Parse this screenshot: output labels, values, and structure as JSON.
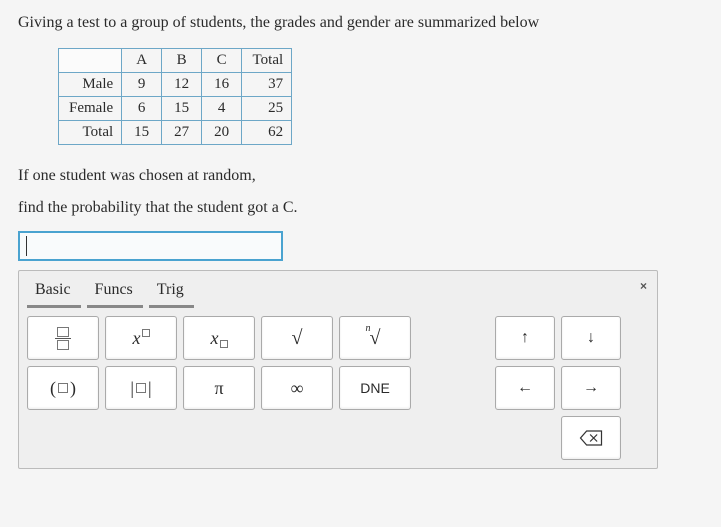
{
  "question": {
    "intro": "Giving a test to a group of students, the grades and gender are summarized below",
    "prompt1": "If one student was chosen at random,",
    "prompt2": "find the probability that the student got a C."
  },
  "table": {
    "col_headers": [
      "A",
      "B",
      "C",
      "Total"
    ],
    "rows": [
      {
        "label": "Male",
        "A": 9,
        "B": 12,
        "C": 16,
        "Total": 37
      },
      {
        "label": "Female",
        "A": 6,
        "B": 15,
        "C": 4,
        "Total": 25
      },
      {
        "label": "Total",
        "A": 15,
        "B": 27,
        "C": 20,
        "Total": 62
      }
    ]
  },
  "answer": {
    "value": ""
  },
  "math_panel": {
    "tabs": [
      "Basic",
      "Funcs",
      "Trig"
    ],
    "keys": {
      "frac": "fraction",
      "xpow": "x^□",
      "xsub": "x□",
      "sqrt": "√",
      "nroot": "ⁿ√",
      "up": "↑",
      "down": "↓",
      "paren": "( )",
      "abs": "| |",
      "pi": "π",
      "inf": "∞",
      "dne": "DNE",
      "left": "←",
      "right": "→",
      "backspace": "⌫"
    },
    "close": "×"
  }
}
